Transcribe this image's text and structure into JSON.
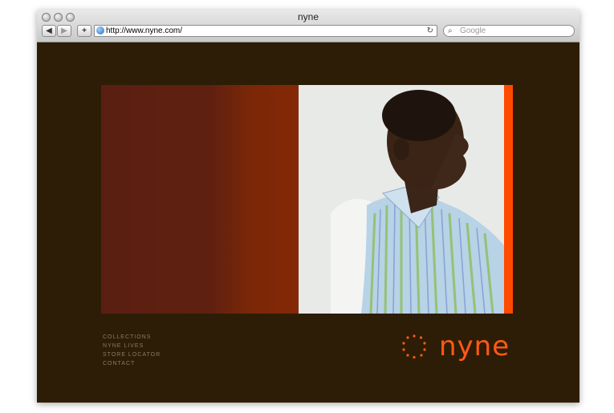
{
  "browser": {
    "title": "nyne",
    "url": "http://www.nyne.com/",
    "search_placeholder": "Google",
    "back_icon": "back-arrow-icon",
    "forward_icon": "forward-arrow-icon",
    "add_icon": "plus-icon",
    "reload_icon": "reload-icon"
  },
  "page": {
    "nav": [
      "COLLECTIONS",
      "NYNE LIVES",
      "STORE LOCATOR",
      "CONTACT"
    ],
    "logo_text": "nyne"
  },
  "colors": {
    "background": "#2d1d06",
    "accent": "#ff4a00",
    "logo": "#ff5a14"
  }
}
